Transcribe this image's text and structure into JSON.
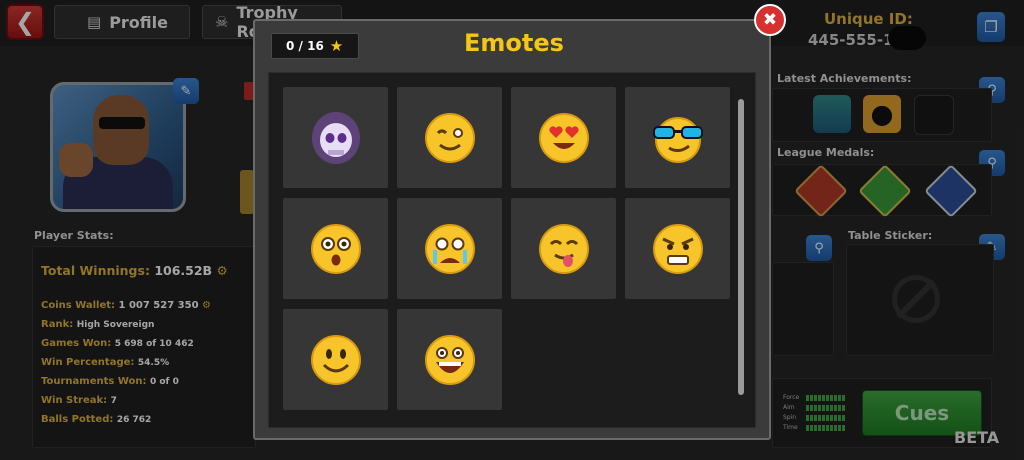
{
  "header": {
    "tabs": [
      {
        "label": "Profile",
        "icon": "profile-card-icon"
      },
      {
        "label": "Trophy Road",
        "icon": "trophy-icon"
      }
    ],
    "unique_id_label": "Unique ID:",
    "unique_id_value": "445-555-1"
  },
  "profile": {
    "stats_title": "Player Stats:",
    "stats": [
      {
        "label": "Total Winnings:",
        "value": "106.52B"
      },
      {
        "label": "Coins Wallet:",
        "value": "1 007 527 350"
      },
      {
        "label": "Rank:",
        "value": "High Sovereign"
      },
      {
        "label": "Games Won:",
        "value": "5 698 of 10 462"
      },
      {
        "label": "Win Percentage:",
        "value": "54.5%"
      },
      {
        "label": "Tournaments Won:",
        "value": "0 of 0"
      },
      {
        "label": "Win Streak:",
        "value": "7"
      },
      {
        "label": "Balls Potted:",
        "value": "26 762"
      }
    ],
    "latest_achievements_title": "Latest Achievements:",
    "league_medals_title": "League Medals:",
    "table_sticker_title": "Table Sticker:",
    "cue_stats": [
      "Force",
      "Aim",
      "Spin",
      "Time"
    ],
    "cues_label": "Cues",
    "beta_label": "BETA"
  },
  "modal": {
    "title": "Emotes",
    "counter": "0 / 16",
    "emotes": [
      {
        "name": "smoke-skull",
        "locked": true
      },
      {
        "name": "wink"
      },
      {
        "name": "heart-eyes"
      },
      {
        "name": "sunglasses"
      },
      {
        "name": "surprised"
      },
      {
        "name": "crying"
      },
      {
        "name": "yum-tongue"
      },
      {
        "name": "angry"
      },
      {
        "name": "smile"
      },
      {
        "name": "laughing"
      }
    ]
  },
  "colors": {
    "title_yellow": "#f5c617",
    "label_gold": "#e0b43c",
    "accent_blue": "#2f6fc0",
    "close_red": "#d63030",
    "cues_green": "#2f8f33"
  }
}
